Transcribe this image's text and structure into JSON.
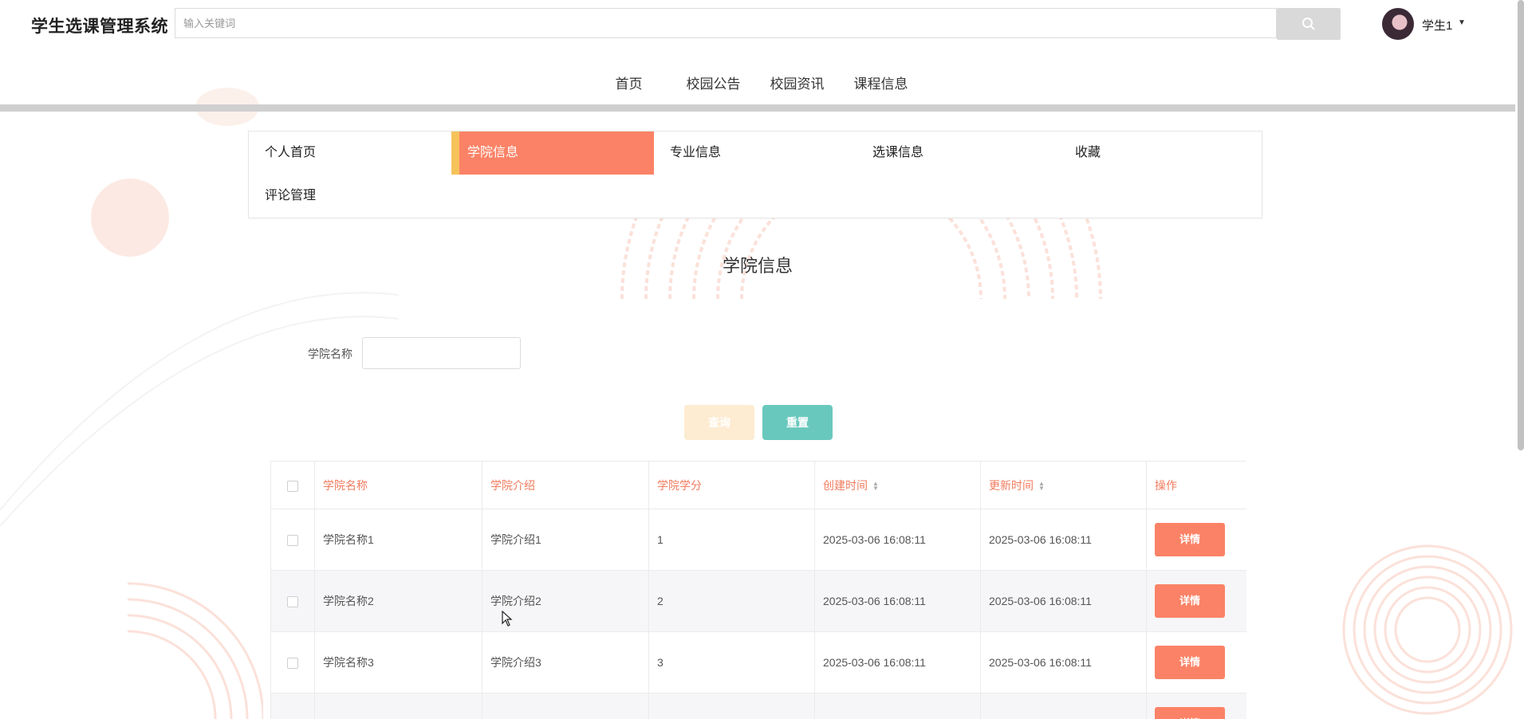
{
  "header": {
    "app_title": "学生选课管理系统",
    "search_placeholder": "输入关键词",
    "user_name": "学生1"
  },
  "nav": {
    "items": [
      {
        "label": "首页",
        "color": "#1aa89a"
      },
      {
        "label": "校园公告",
        "color": "#f56f55"
      },
      {
        "label": "校园资讯",
        "color": "#f6c35b"
      },
      {
        "label": "课程信息",
        "color": "#2e86de"
      }
    ]
  },
  "menu": {
    "items": [
      {
        "label": "个人首页",
        "active": false
      },
      {
        "label": "学院信息",
        "active": true
      },
      {
        "label": "专业信息",
        "active": false
      },
      {
        "label": "选课信息",
        "active": false
      },
      {
        "label": "收藏",
        "active": false
      },
      {
        "label": "评论管理",
        "active": false
      }
    ]
  },
  "page": {
    "title": "学院信息"
  },
  "filter": {
    "label": "学院名称",
    "value": "",
    "query_label": "查询",
    "reset_label": "重置"
  },
  "table": {
    "columns": [
      "学院名称",
      "学院介绍",
      "学院学分",
      "创建时间",
      "更新时间",
      "操作"
    ],
    "rows": [
      {
        "name": "学院名称1",
        "intro": "学院介绍1",
        "credit": "1",
        "created": "2025-03-06 16:08:11",
        "updated": "2025-03-06 16:08:11",
        "action": "详情"
      },
      {
        "name": "学院名称2",
        "intro": "学院介绍2",
        "credit": "2",
        "created": "2025-03-06 16:08:11",
        "updated": "2025-03-06 16:08:11",
        "action": "详情"
      },
      {
        "name": "学院名称3",
        "intro": "学院介绍3",
        "credit": "3",
        "created": "2025-03-06 16:08:11",
        "updated": "2025-03-06 16:08:11",
        "action": "详情"
      },
      {
        "name": "",
        "intro": "",
        "credit": "",
        "created": "",
        "updated": "",
        "action": "详情"
      }
    ]
  },
  "icons": {
    "search": "search-icon",
    "caret": "caret-down-icon",
    "sort": "sort-icon",
    "cursor": "mouse-cursor-icon"
  }
}
